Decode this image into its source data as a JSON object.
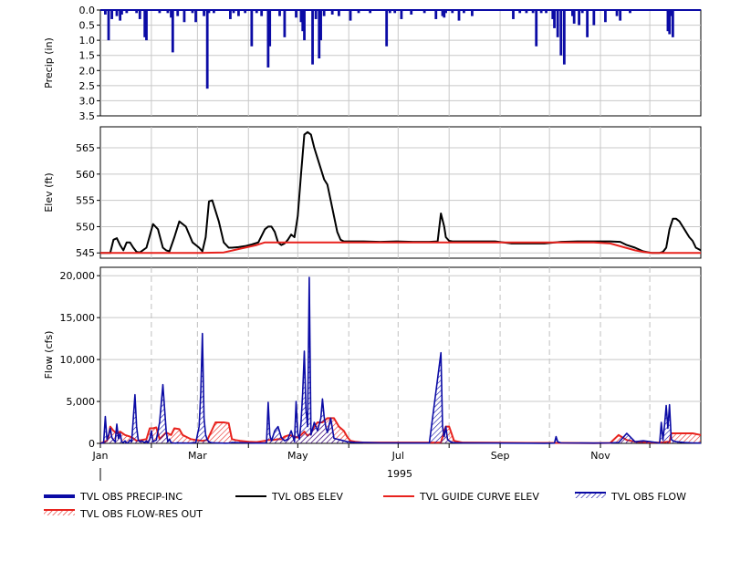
{
  "colors": {
    "precip": "#0b0ba5",
    "obs_elev": "#000000",
    "guide": "#e8231e",
    "obs_flow": "#0b0ba5",
    "res_out": "#e8231e",
    "grid": "#c8c8c8",
    "dashed_grid": "#c0c0c0"
  },
  "legend": {
    "items": [
      {
        "label": "TVL OBS PRECIP-INC",
        "style": "thick-line",
        "color": "#0b0ba5"
      },
      {
        "label": "TVL OBS ELEV",
        "style": "line",
        "color": "#000000"
      },
      {
        "label": "TVL GUIDE CURVE ELEV",
        "style": "line",
        "color": "#e8231e"
      },
      {
        "label": "TVL OBS FLOW",
        "style": "hatched",
        "color": "#0b0ba5"
      },
      {
        "label": "TVL OBS FLOW-RES OUT",
        "style": "hatched",
        "color": "#e8231e"
      }
    ]
  },
  "x_axis": {
    "year": "1995",
    "month_labels": [
      {
        "label": "Jan",
        "day": 0
      },
      {
        "label": "Mar",
        "day": 59
      },
      {
        "label": "May",
        "day": 120
      },
      {
        "label": "Jul",
        "day": 181
      },
      {
        "label": "Sep",
        "day": 243
      },
      {
        "label": "Nov",
        "day": 304
      }
    ],
    "month_starts": [
      0,
      31,
      59,
      90,
      120,
      151,
      181,
      212,
      243,
      273,
      304,
      334
    ],
    "xlim": [
      0,
      365
    ]
  },
  "chart_data": [
    {
      "type": "bar",
      "ylabel": "Precip (in)",
      "ylim": [
        0,
        3.5
      ],
      "inverted": true,
      "yticks": [
        "0.0",
        "0.5",
        "1.0",
        "1.5",
        "2.0",
        "2.5",
        "3.0",
        "3.5"
      ],
      "ytick_values": [
        0,
        0.5,
        1.0,
        1.5,
        2.0,
        2.5,
        3.0,
        3.5
      ],
      "series": [
        {
          "name": "TVL OBS PRECIP-INC",
          "x": [
            3,
            5,
            7,
            10,
            12,
            13,
            16,
            22,
            24,
            27,
            28,
            36,
            41,
            43,
            44,
            47,
            51,
            56,
            58,
            63,
            65,
            66,
            69,
            79,
            81,
            84,
            88,
            92,
            95,
            98,
            102,
            103,
            109,
            112,
            119,
            122,
            123,
            124,
            129,
            131,
            133,
            134,
            136,
            141,
            145,
            152,
            157,
            164,
            174,
            176,
            179,
            183,
            189,
            197,
            204,
            208,
            209,
            210,
            214,
            218,
            221,
            226,
            251,
            255,
            259,
            263,
            265,
            268,
            271,
            275,
            276,
            278,
            280,
            282,
            287,
            288,
            291,
            293,
            296,
            300,
            307,
            314,
            316,
            322,
            345,
            346,
            347,
            348
          ],
          "values": [
            0.15,
            1.0,
            0.3,
            0.2,
            0.35,
            0.15,
            0.1,
            0.1,
            0.3,
            0.9,
            1.0,
            0.1,
            0.1,
            0.25,
            1.4,
            0.2,
            0.4,
            0.1,
            0.4,
            0.2,
            2.6,
            0.1,
            0.1,
            0.3,
            0.1,
            0.2,
            0.1,
            1.2,
            0.1,
            0.2,
            1.9,
            1.2,
            0.2,
            0.9,
            0.25,
            0.4,
            0.7,
            1.0,
            1.8,
            0.3,
            1.6,
            1.0,
            0.2,
            0.15,
            0.2,
            0.35,
            0.1,
            0.1,
            1.2,
            0.1,
            0.1,
            0.3,
            0.15,
            0.1,
            0.3,
            0.2,
            0.25,
            0.1,
            0.1,
            0.35,
            0.1,
            0.2,
            0.3,
            0.1,
            0.1,
            0.1,
            1.2,
            0.1,
            0.1,
            0.3,
            0.6,
            0.9,
            1.5,
            1.8,
            0.2,
            0.45,
            0.5,
            0.1,
            0.9,
            0.5,
            0.4,
            0.2,
            0.35,
            0.1,
            0.7,
            0.8,
            0.2,
            0.9
          ]
        }
      ]
    },
    {
      "type": "line",
      "ylabel": "Elev (ft)",
      "ylim": [
        544,
        569
      ],
      "yticks": [
        "545",
        "550",
        "555",
        "560",
        "565"
      ],
      "ytick_values": [
        545,
        550,
        555,
        560,
        565
      ],
      "series": [
        {
          "name": "TVL OBS ELEV",
          "x": [
            0,
            4,
            6,
            8,
            10,
            12,
            14,
            16,
            18,
            20,
            22,
            24,
            28,
            32,
            35,
            38,
            40,
            42,
            45,
            48,
            52,
            56,
            60,
            62,
            64,
            66,
            68,
            70,
            72,
            75,
            78,
            80,
            84,
            88,
            92,
            96,
            100,
            102,
            104,
            106,
            108,
            110,
            112,
            114,
            116,
            118,
            120,
            122,
            124,
            126,
            128,
            130,
            132,
            134,
            136,
            138,
            140,
            142,
            144,
            146,
            148,
            150,
            154,
            160,
            170,
            180,
            190,
            200,
            205,
            207,
            209,
            210,
            212,
            214,
            216,
            220,
            230,
            240,
            250,
            260,
            270,
            280,
            290,
            300,
            310,
            316,
            320,
            325,
            330,
            335,
            340,
            342,
            344,
            346,
            348,
            350,
            352,
            354,
            356,
            358,
            360,
            362,
            365
          ],
          "y": [
            545,
            545,
            545,
            547.5,
            547.8,
            546.5,
            545.5,
            547,
            547,
            546,
            545.2,
            545.1,
            546,
            550.5,
            549.5,
            546,
            545.5,
            545.3,
            548,
            551,
            550,
            547,
            546,
            545.3,
            548,
            554.8,
            555,
            553,
            551,
            547,
            546,
            546,
            546.1,
            546.3,
            546.6,
            547,
            549.5,
            550,
            550,
            549,
            547,
            546.5,
            546.8,
            547.5,
            548.5,
            548,
            552,
            560,
            567.5,
            568,
            567.5,
            565,
            563,
            561,
            559,
            558,
            555,
            552,
            549,
            547.5,
            547.2,
            547.2,
            547.2,
            547.2,
            547.1,
            547.2,
            547.1,
            547.1,
            547.2,
            552.5,
            550,
            548,
            547.3,
            547.2,
            547.2,
            547.2,
            547.2,
            547.2,
            546.8,
            546.8,
            546.8,
            547.1,
            547.2,
            547.2,
            547.2,
            547.1,
            546.5,
            546,
            545.3,
            545,
            545,
            545.2,
            546,
            549.5,
            551.5,
            551.5,
            551,
            550,
            549,
            548,
            547.3,
            546,
            545.5
          ]
        },
        {
          "name": "TVL GUIDE CURVE ELEV",
          "x": [
            0,
            20,
            40,
            60,
            75,
            85,
            95,
            100,
            120,
            150,
            180,
            210,
            240,
            270,
            300,
            310,
            325,
            330,
            335,
            365
          ],
          "y": [
            545,
            545,
            545,
            545,
            545.1,
            545.8,
            546.5,
            547,
            547,
            547,
            547,
            547,
            547,
            547,
            547,
            546.8,
            545.5,
            545.2,
            545,
            545
          ]
        }
      ]
    },
    {
      "type": "area",
      "ylabel": "Flow (cfs)",
      "ylim": [
        0,
        21000
      ],
      "yticks": [
        "0",
        "5,000",
        "10,000",
        "15,000",
        "20,000"
      ],
      "ytick_values": [
        0,
        5000,
        10000,
        15000,
        20000
      ],
      "series": [
        {
          "name": "TVL OBS FLOW",
          "x": [
            0,
            2,
            3,
            4,
            5,
            6,
            7,
            8,
            9,
            10,
            11,
            12,
            13,
            14,
            15,
            16,
            17,
            18,
            19,
            20,
            21,
            22,
            23,
            24,
            25,
            26,
            27,
            28,
            29,
            30,
            31,
            32,
            34,
            36,
            38,
            40,
            41,
            42,
            43,
            44,
            45,
            46,
            47,
            48,
            50,
            52,
            55,
            58,
            60,
            61,
            62,
            63,
            64,
            65,
            66,
            67,
            68,
            70,
            72,
            74,
            76,
            78,
            80,
            85,
            90,
            95,
            100,
            101,
            102,
            103,
            104,
            106,
            108,
            110,
            112,
            114,
            116,
            118,
            119,
            120,
            121,
            122,
            123,
            124,
            125,
            126,
            127,
            128,
            130,
            132,
            134,
            135,
            136,
            137,
            138,
            140,
            142,
            144,
            146,
            150,
            155,
            160,
            170,
            180,
            200,
            207,
            208,
            209,
            210,
            211,
            212,
            214,
            216,
            220,
            240,
            260,
            270,
            276,
            277,
            278,
            280,
            300,
            310,
            315,
            320,
            325,
            330,
            338,
            339,
            340,
            341,
            342,
            343,
            344,
            345,
            346,
            347,
            348,
            350,
            355,
            360,
            365
          ],
          "y": [
            0,
            100,
            3200,
            500,
            1000,
            1800,
            700,
            400,
            200,
            2300,
            600,
            1200,
            200,
            100,
            300,
            50,
            100,
            400,
            200,
            3000,
            5800,
            2000,
            400,
            200,
            300,
            200,
            100,
            300,
            50,
            500,
            1500,
            200,
            400,
            2500,
            7000,
            1500,
            200,
            500,
            100,
            50,
            30,
            20,
            100,
            30,
            50,
            30,
            40,
            100,
            2000,
            6000,
            13100,
            3000,
            1000,
            400,
            200,
            100,
            80,
            50,
            40,
            30,
            20,
            30,
            100,
            80,
            50,
            30,
            30,
            100,
            4900,
            1000,
            300,
            1500,
            2000,
            700,
            300,
            500,
            1500,
            200,
            5000,
            1200,
            500,
            2500,
            6000,
            11000,
            4000,
            2000,
            19800,
            1000,
            2500,
            1500,
            3000,
            5300,
            3200,
            2000,
            1300,
            3000,
            600,
            500,
            400,
            200,
            100,
            100,
            50,
            50,
            30,
            10800,
            2000,
            800,
            2000,
            500,
            300,
            100,
            80,
            50,
            30,
            20,
            10,
            30,
            800,
            200,
            50,
            30,
            50,
            100,
            1200,
            200,
            300,
            100,
            50,
            30,
            2500,
            400,
            2200,
            4500,
            1800,
            4600,
            500,
            300,
            200,
            100,
            50,
            30
          ]
        },
        {
          "name": "TVL OBS FLOW-RES OUT",
          "x": [
            0,
            4,
            5,
            6,
            8,
            10,
            12,
            15,
            18,
            20,
            22,
            25,
            28,
            30,
            32,
            34,
            36,
            40,
            43,
            45,
            48,
            50,
            52,
            55,
            58,
            62,
            65,
            70,
            72,
            75,
            78,
            80,
            82,
            85,
            90,
            95,
            100,
            102,
            105,
            108,
            110,
            112,
            115,
            118,
            120,
            122,
            124,
            126,
            128,
            130,
            132,
            135,
            138,
            140,
            142,
            145,
            148,
            150,
            152,
            155,
            160,
            170,
            180,
            200,
            205,
            207,
            209,
            210,
            212,
            215,
            220,
            240,
            260,
            280,
            300,
            310,
            315,
            320,
            325,
            330,
            335,
            340,
            345,
            346,
            347,
            348,
            350,
            355,
            360,
            365
          ],
          "y": [
            0,
            300,
            800,
            2000,
            1500,
            1200,
            1400,
            1000,
            800,
            600,
            300,
            400,
            500,
            1800,
            1800,
            1900,
            500,
            1300,
            1000,
            1800,
            1700,
            1000,
            800,
            500,
            400,
            300,
            400,
            2500,
            2500,
            2500,
            2400,
            500,
            400,
            300,
            200,
            150,
            300,
            400,
            400,
            500,
            500,
            800,
            1000,
            800,
            700,
            1000,
            1400,
            900,
            1200,
            2000,
            2500,
            2500,
            3000,
            3000,
            3000,
            2000,
            1500,
            800,
            300,
            200,
            100,
            100,
            100,
            100,
            100,
            100,
            1500,
            2000,
            2000,
            300,
            100,
            80,
            50,
            50,
            30,
            50,
            1000,
            400,
            200,
            150,
            100,
            100,
            200,
            100,
            1200,
            1200,
            1200,
            1200,
            1200,
            1000
          ]
        }
      ]
    }
  ]
}
